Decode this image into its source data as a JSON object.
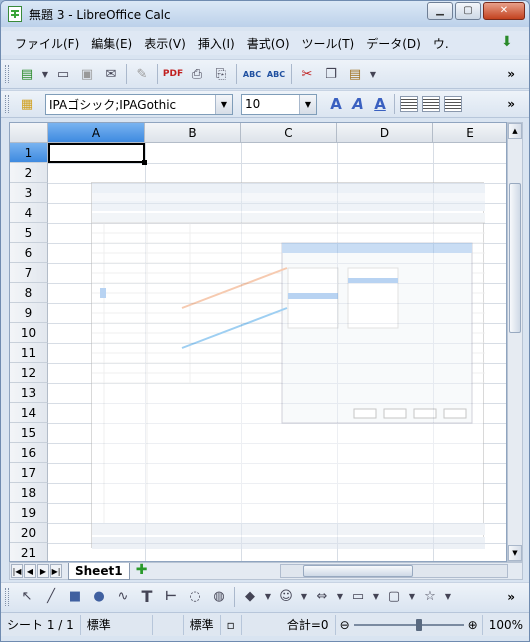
{
  "window": {
    "title": "無題 3 - LibreOffice Calc"
  },
  "menu": [
    "ファイル(F)",
    "編集(E)",
    "表示(V)",
    "挿入(I)",
    "書式(O)",
    "ツール(T)",
    "データ(D)",
    "ウ."
  ],
  "toolbar": {
    "more": "»"
  },
  "formatting": {
    "font_name": "IPAゴシック;IPAGothic",
    "font_size": "10"
  },
  "sheet": {
    "columns": [
      "A",
      "B",
      "C",
      "D",
      "E"
    ],
    "rows": [
      "1",
      "2",
      "3",
      "4",
      "5",
      "6",
      "7",
      "8",
      "9",
      "10",
      "11",
      "12",
      "13",
      "14",
      "15",
      "16",
      "17",
      "18",
      "19",
      "20",
      "21"
    ],
    "selected_cell": "A1"
  },
  "tabs": {
    "sheet1": "Sheet1"
  },
  "status": {
    "sheet_pos": "シート 1 / 1",
    "page_style": "標準",
    "mode": "標準",
    "sum": "合計=0",
    "zoom": "100%"
  }
}
